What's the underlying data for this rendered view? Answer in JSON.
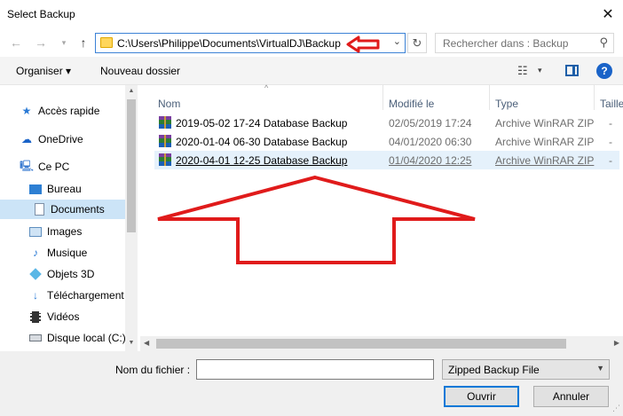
{
  "window": {
    "title": "Select Backup",
    "close_symbol": "✕"
  },
  "nav": {
    "back_symbol": "←",
    "forward_symbol": "→",
    "recent_symbol": "▾",
    "up_symbol": "↑",
    "address": "C:\\Users\\Philippe\\Documents\\VirtualDJ\\Backup",
    "address_dropdown_symbol": "⌄",
    "refresh_symbol": "↻",
    "search_placeholder": "Rechercher dans : Backup",
    "search_symbol": "⚲"
  },
  "toolbar": {
    "organise_label": "Organiser ▾",
    "new_folder_label": "Nouveau dossier",
    "view_symbol": "☷",
    "view_dropdown_symbol": "▾",
    "help_symbol": "?"
  },
  "sidebar": {
    "items": [
      {
        "label": "Accès rapide",
        "icon": "quick-access-star-icon"
      },
      {
        "label": "OneDrive",
        "icon": "onedrive-cloud-icon"
      },
      {
        "label": "Ce PC",
        "icon": "this-pc-icon"
      },
      {
        "label": "Bureau",
        "icon": "desktop-icon"
      },
      {
        "label": "Documents",
        "icon": "documents-icon",
        "selected": true
      },
      {
        "label": "Images",
        "icon": "pictures-icon"
      },
      {
        "label": "Musique",
        "icon": "music-icon"
      },
      {
        "label": "Objets 3D",
        "icon": "3d-objects-icon"
      },
      {
        "label": "Téléchargement",
        "icon": "downloads-icon"
      },
      {
        "label": "Vidéos",
        "icon": "videos-icon"
      },
      {
        "label": "Disque local (C:)",
        "icon": "local-disk-icon"
      }
    ]
  },
  "file_list": {
    "columns": [
      "Nom",
      "Modifié le",
      "Type",
      "Taille"
    ],
    "rows": [
      {
        "name": "2019-05-02 17-24 Database Backup",
        "modified": "02/05/2019 17:24",
        "type": "Archive WinRAR ZIP"
      },
      {
        "name": "2020-01-04 06-30 Database Backup",
        "modified": "04/01/2020 06:30",
        "type": "Archive WinRAR ZIP"
      },
      {
        "name": "2020-04-01 12-25 Database Backup",
        "modified": "01/04/2020 12:25",
        "type": "Archive WinRAR ZIP",
        "selected": true
      }
    ],
    "overflow_marks": [
      "-",
      "-",
      "-"
    ]
  },
  "footer": {
    "filename_label": "Nom du fichier :",
    "filename_value": "",
    "file_type": "Zipped Backup File",
    "open_label": "Ouvrir",
    "cancel_label": "Annuler"
  },
  "colors": {
    "accent": "#0078d7",
    "selection": "#cce4f7",
    "annotation_red": "#e01b1b"
  }
}
